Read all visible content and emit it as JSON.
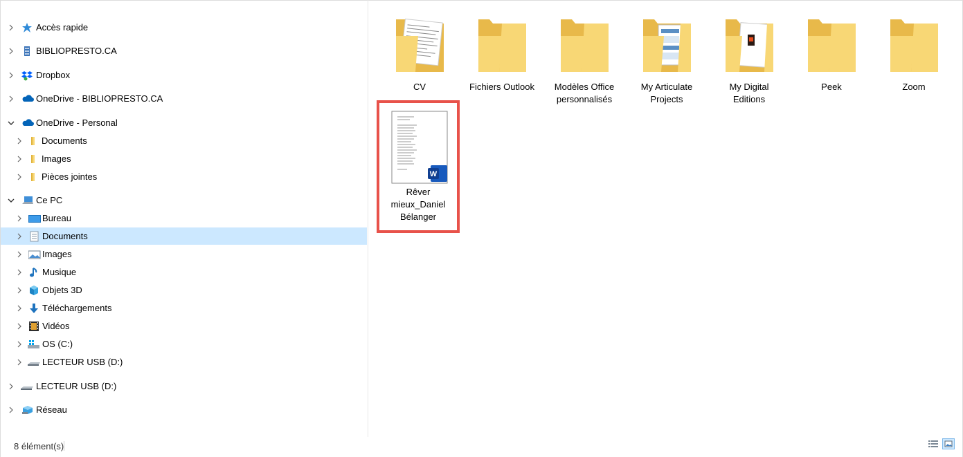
{
  "nav": {
    "quick_access": "Accès rapide",
    "bibliopresto": "BIBLIOPRESTO.CA",
    "dropbox": "Dropbox",
    "onedrive_biblio": "OneDrive - BIBLIOPRESTO.CA",
    "onedrive_personal": "OneDrive - Personal",
    "od_documents": "Documents",
    "od_images": "Images",
    "od_pieces": "Pièces jointes",
    "this_pc": "Ce PC",
    "pc_bureau": "Bureau",
    "pc_documents": "Documents",
    "pc_images": "Images",
    "pc_musique": "Musique",
    "pc_objets3d": "Objets 3D",
    "pc_telechargements": "Téléchargements",
    "pc_videos": "Vidéos",
    "pc_os": "OS (C:)",
    "pc_usb": "LECTEUR USB (D:)",
    "usb_root": "LECTEUR USB (D:)",
    "network": "Réseau"
  },
  "files": {
    "cv": "CV",
    "outlook": "Fichiers Outlook",
    "models_l1": "Modèles Office",
    "models_l2": "personnalisés",
    "articulate_l1": "My Articulate",
    "articulate_l2": "Projects",
    "digital_l1": "My Digital",
    "digital_l2": "Editions",
    "peek": "Peek",
    "zoom": "Zoom",
    "doc_l1": "Rêver",
    "doc_l2": "mieux_Daniel",
    "doc_l3": "Bélanger"
  },
  "status": {
    "count": "8 élément(s)"
  },
  "colors": {
    "selection_bg": "#cce8ff",
    "highlight_border": "#e8524a",
    "folder": "#f8d775",
    "word_blue": "#185abd"
  }
}
